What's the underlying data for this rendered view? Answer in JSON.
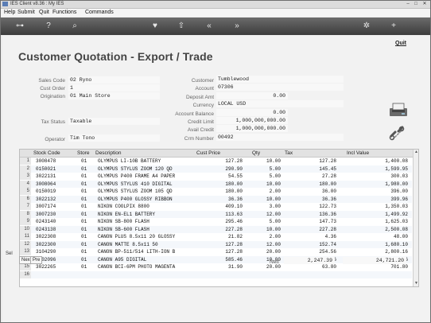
{
  "window": {
    "title": "IES Client v8.36 : My IES"
  },
  "menu": {
    "items": [
      "Help",
      "Submit",
      "Quit",
      "Functions",
      "Commands"
    ]
  },
  "toolbar": {
    "icons": [
      "key-icon",
      "help-icon",
      "search-icon",
      "heart-icon",
      "up-icon",
      "rewind-icon",
      "forward-icon",
      "gear-icon",
      "plus-icon"
    ]
  },
  "page": {
    "title": "Customer Quotation - Export / Trade",
    "quit_label": "Quit"
  },
  "form": {
    "sales_code": {
      "label": "Sales Code",
      "value": "02 Ryno"
    },
    "cust_order": {
      "label": "Cust Order",
      "value": "1"
    },
    "origination": {
      "label": "Origination",
      "value": "01 Main Store"
    },
    "tax_status": {
      "label": "Tax Status",
      "value": "Taxable"
    },
    "operator": {
      "label": "Operator",
      "value": "Tim Tono"
    },
    "customer": {
      "label": "Customer",
      "value": "Tumblewood"
    },
    "account": {
      "label": "Account",
      "value": "07306"
    },
    "deposit_amt": {
      "label": "Deposit Amt",
      "value": "0.00"
    },
    "currency": {
      "label": "Currency",
      "value": "LOCAL USD"
    },
    "account_balance": {
      "label": "Account Balance",
      "value": "0.00"
    },
    "credit_limit": {
      "label": "Credit Limit",
      "value": "1,000,000,000.00"
    },
    "avail_credit": {
      "label": "Avail Credit",
      "value": "1,000,000,000.00"
    },
    "crm_number": {
      "label": "Crm Number",
      "value": "00492"
    }
  },
  "grid": {
    "columns": [
      "Stock Code",
      "Store",
      "Description",
      "Cust Price",
      "Qty",
      "Tax",
      "Incl Value"
    ],
    "rows": [
      {
        "n": "1",
        "code": "3008478",
        "store": "01",
        "desc": "OLYMPUS LI-10B BATTERY",
        "price": "127.28",
        "qty": "10.00",
        "tax": "127.28",
        "incl": "1,400.08"
      },
      {
        "n": "2",
        "code": "0150021",
        "store": "01",
        "desc": "OLYMPUS STYLUS ZOOM 120 QD",
        "price": "290.90",
        "qty": "5.00",
        "tax": "145.45",
        "incl": "1,599.95"
      },
      {
        "n": "3",
        "code": "3022131",
        "store": "01",
        "desc": "OLYMPUS P400 FRAME A4 PAPER",
        "price": "54.55",
        "qty": "5.00",
        "tax": "27.28",
        "incl": "300.03"
      },
      {
        "n": "4",
        "code": "3008064",
        "store": "01",
        "desc": "OLYMPUS STYLUS 410 DIGITAL",
        "price": "180.00",
        "qty": "10.00",
        "tax": "180.00",
        "incl": "1,980.00"
      },
      {
        "n": "5",
        "code": "0150019",
        "store": "01",
        "desc": "OLYMPUS STYLUS ZOOM 105 QD",
        "price": "180.00",
        "qty": "2.00",
        "tax": "36.00",
        "incl": "396.00"
      },
      {
        "n": "6",
        "code": "3022132",
        "store": "01",
        "desc": "OLYMPUS P400 GLOSSY RIBBON",
        "price": "36.36",
        "qty": "10.00",
        "tax": "36.36",
        "incl": "399.96"
      },
      {
        "n": "7",
        "code": "3007174",
        "store": "01",
        "desc": "NIKON COOLPIX 8800",
        "price": "409.10",
        "qty": "3.00",
        "tax": "122.73",
        "incl": "1,350.03"
      },
      {
        "n": "8",
        "code": "3007230",
        "store": "01",
        "desc": "NIKON EN-EL1 BATTERY",
        "price": "113.63",
        "qty": "12.00",
        "tax": "136.36",
        "incl": "1,499.92"
      },
      {
        "n": "9",
        "code": "0243140",
        "store": "01",
        "desc": "NIKON SB-800 FLASH",
        "price": "295.46",
        "qty": "5.00",
        "tax": "147.73",
        "incl": "1,625.03"
      },
      {
        "n": "10",
        "code": "0243138",
        "store": "01",
        "desc": "NIKON SB-600 FLASH",
        "price": "227.28",
        "qty": "10.00",
        "tax": "227.28",
        "incl": "2,500.08"
      },
      {
        "n": "11",
        "code": "3022308",
        "store": "01",
        "desc": "CANON PLUS 8.5x11 20 GLOSSY",
        "price": "21.82",
        "qty": "2.00",
        "tax": "4.36",
        "incl": "48.00"
      },
      {
        "n": "12",
        "code": "3022300",
        "store": "01",
        "desc": "CANON MATTE 8.5x11 50",
        "price": "127.28",
        "qty": "12.00",
        "tax": "152.74",
        "incl": "1,680.10"
      },
      {
        "n": "13",
        "code": "3104290",
        "store": "01",
        "desc": "CANON BP-511/514 LITH-ION B",
        "price": "127.28",
        "qty": "20.00",
        "tax": "254.56",
        "incl": "2,800.16"
      },
      {
        "n": "14",
        "code": "3002096",
        "store": "01",
        "desc": "CANON A95 DIGITAL",
        "price": "585.46",
        "qty": "10.00",
        "tax": "585.46",
        "incl": "6,440.06"
      },
      {
        "n": "15",
        "code": "3022265",
        "store": "01",
        "desc": "CANON BCI-6PM PHOTO MAGENTA",
        "price": "31.90",
        "qty": "20.00",
        "tax": "63.80",
        "incl": "701.80"
      },
      {
        "n": "16",
        "code": "",
        "store": "",
        "desc": "",
        "price": "",
        "qty": "",
        "tax": "",
        "incl": ""
      }
    ]
  },
  "tabs": {
    "next": "Nex",
    "prev": "Pre",
    "side": "Sel"
  },
  "footer": {
    "nett_label": "Nett",
    "tax_total": "2,247.39",
    "incl_total": "24,721.20"
  }
}
